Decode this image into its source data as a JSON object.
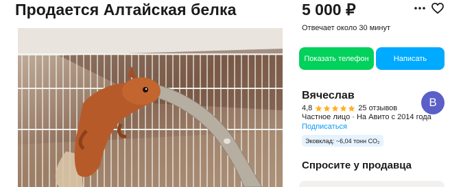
{
  "listing": {
    "title": "Продается Алтайская белка",
    "photo_icon": "squirrel-photo"
  },
  "price": "5 000 ₽",
  "actions": {
    "more_icon": "more-dots-icon",
    "favorite_icon": "heart-icon"
  },
  "response_time": "Отвечает около 30 минут",
  "buttons": {
    "show_phone": "Показать телефон",
    "write": "Написать"
  },
  "seller": {
    "name": "Вячеслав",
    "rating": "4,8",
    "stars": 5,
    "reviews": "25 отзывов",
    "type": "Частное лицо · На Авито с 2014 года",
    "subscribe": "Подписаться",
    "eco": "Эковклад: ~6,04 тонн CO₂",
    "avatar_letter": "В",
    "avatar_color": "#5b5fc7"
  },
  "ask_seller": {
    "title": "Спросите у продавца"
  },
  "colors": {
    "green": "#02d15c",
    "blue": "#00aaff",
    "link": "#0099f7",
    "star": "#ffb021"
  }
}
